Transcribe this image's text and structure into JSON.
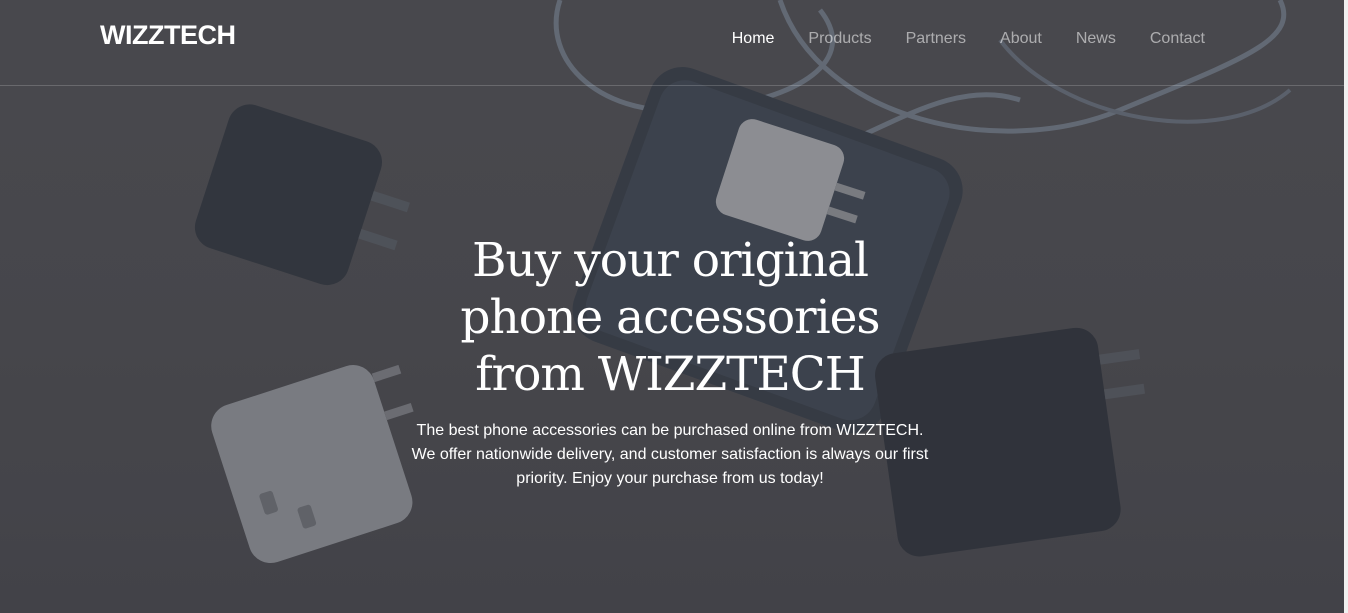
{
  "header": {
    "brand": "WIZZTECH",
    "nav": [
      {
        "label": "Home",
        "active": true
      },
      {
        "label": "Products",
        "active": false
      },
      {
        "label": "Partners",
        "active": false
      },
      {
        "label": "About",
        "active": false
      },
      {
        "label": "News",
        "active": false
      },
      {
        "label": "Contact",
        "active": false
      }
    ]
  },
  "hero": {
    "title_lines": [
      "Buy your original",
      "phone accessories",
      "from WIZZTECH"
    ],
    "description": "The best phone accessories can be purchased online from WIZZTECH. We offer nationwide delivery, and customer satisfaction is always our first priority. Enjoy your purchase from us today!",
    "background_image": "phone-with-chargers-photo"
  },
  "colors": {
    "overlay": "#4a4a4e",
    "text": "#ffffff",
    "nav_inactive": "#a9a9ab"
  }
}
